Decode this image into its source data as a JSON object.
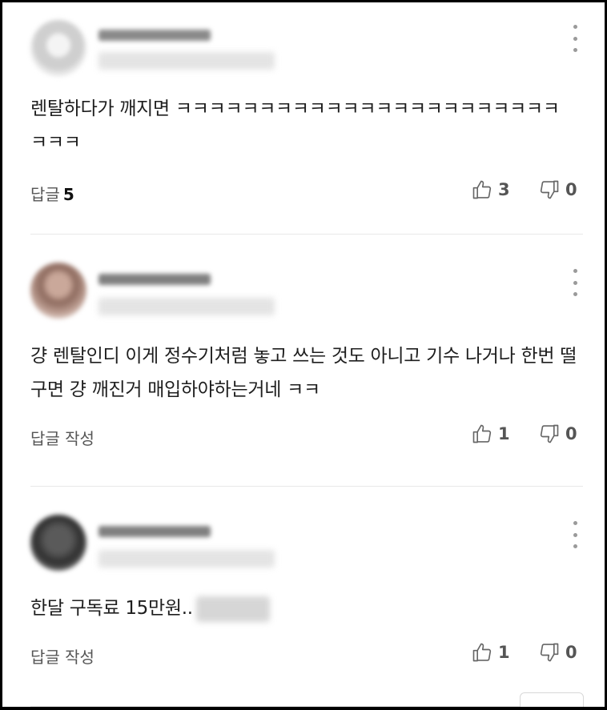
{
  "comments": [
    {
      "text": "렌탈하다가 깨지면 ㅋㅋㅋㅋㅋㅋㅋㅋㅋㅋㅋㅋㅋㅋㅋㅋㅋㅋㅋㅋㅋㅋㅋㅋㅋㅋ",
      "reply_label": "답글",
      "reply_count": "5",
      "likes": "3",
      "dislikes": "0",
      "avatar_color": "#d9d9d9"
    },
    {
      "text": "걍 렌탈인디 이게 정수기처럼 놓고 쓰는 것도 아니고 기수 나거나 한번 떨구면 걍 깨진거 매입하야하는거네 ㅋㅋ",
      "reply_label": "답글 작성",
      "likes": "1",
      "dislikes": "0",
      "avatar_color": "#a8837a"
    },
    {
      "text": "한달 구독료 15만원..",
      "reply_label": "답글 작성",
      "likes": "1",
      "dislikes": "0",
      "avatar_color": "#3c3c3c"
    }
  ]
}
